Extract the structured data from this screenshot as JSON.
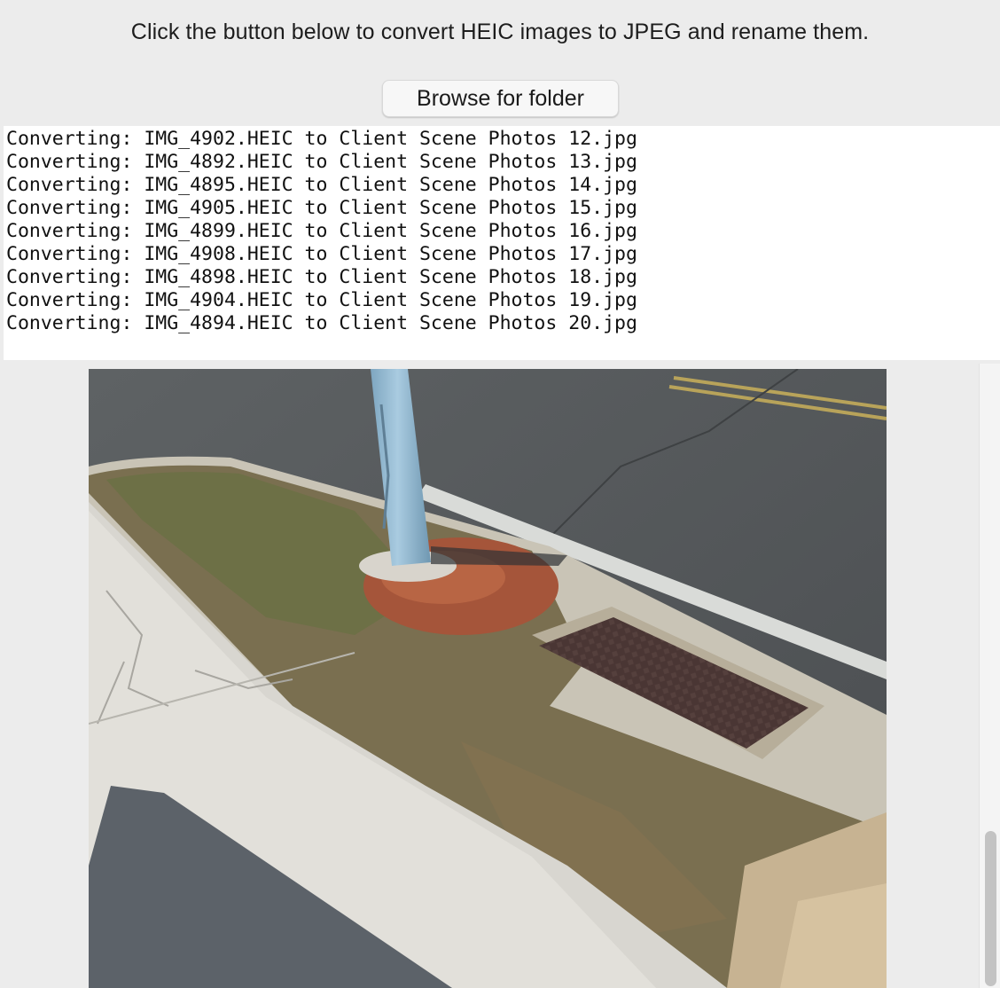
{
  "header": {
    "instruction": "Click the button below to convert HEIC images to JPEG and rename them.",
    "browse_label": "Browse for folder"
  },
  "log": {
    "lines": [
      "Converting: IMG_4902.HEIC to Client Scene Photos 12.jpg",
      "Converting: IMG_4892.HEIC to Client Scene Photos 13.jpg",
      "Converting: IMG_4895.HEIC to Client Scene Photos 14.jpg",
      "Converting: IMG_4905.HEIC to Client Scene Photos 15.jpg",
      "Converting: IMG_4899.HEIC to Client Scene Photos 16.jpg",
      "Converting: IMG_4908.HEIC to Client Scene Photos 17.jpg",
      "Converting: IMG_4898.HEIC to Client Scene Photos 18.jpg",
      "Converting: IMG_4904.HEIC to Client Scene Photos 19.jpg",
      "Converting: IMG_4894.HEIC to Client Scene Photos 20.jpg"
    ]
  },
  "preview": {
    "icon": "photo-preview-image"
  },
  "colors": {
    "window_background": "#ececec",
    "log_background": "#ffffff",
    "button_background": "#f7f7f7",
    "scroll_thumb": "#c3c3c3"
  }
}
